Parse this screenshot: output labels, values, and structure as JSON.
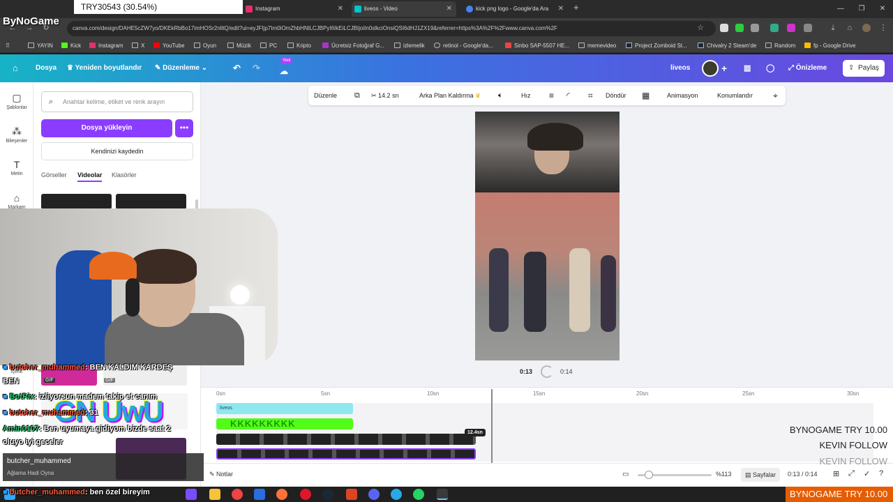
{
  "stream": {
    "brand": "ByNoGame",
    "currency_top": "TRY30543 (30.54%)",
    "ticker_right_1": "BYNOGAME  TRY 10.00",
    "ticker_right_2": "KEVIN  FOLLOW",
    "ticker_right_3": "KEVIN  FOLLOW",
    "ticker_bottom": "BYNOGAME  TRY 10.00",
    "chat": [
      {
        "user": "butcher_muhammed",
        "text": ": BEN KALDIM KARDEŞ"
      },
      {
        "user": "",
        "text": "BEN"
      },
      {
        "user": "BotRix",
        "text": ": izliyorsun madem takip et canım"
      },
      {
        "user": "butcher_muhammed",
        "text": ": 31"
      },
      {
        "user": "Amin0107",
        "text": ": Ben uyumaya gidiyom bizde saat 2"
      },
      {
        "user": "",
        "text": "oluyo iyi geceler"
      },
      {
        "user": "butcher_muhammed",
        "text": ": ben özel bireyim"
      }
    ],
    "alert": {
      "user": "butcher_muhammed",
      "text": "Ağlama Hadi Oyna"
    }
  },
  "browser": {
    "tabs": [
      {
        "label": "Instagram",
        "color": "#e1306c"
      },
      {
        "label": "liveos - Video",
        "color": "#00c4cc"
      },
      {
        "label": "kick png logo - Google'da Ara",
        "color": "#4285f4"
      }
    ],
    "new_tab": "+",
    "url": "canva.com/design/DAHE5cZW7yo/DKEkRbBo17imHOSr2nlltQ/edit?ui=eyJFIjp7Im0iOmZhbHNlLCJBPyI6IkEiLCJBIjoiIn0slkciOnsiQSI6dHJ1ZX19&referrer=https%3A%2F%2Fwww.canva.com%2F",
    "bookmarks": [
      "YAYIN",
      "Kick",
      "Instagram",
      "X",
      "YouTube",
      "Oyun",
      "Müzik",
      "PC",
      "Kripto",
      "Ücretsiz Fotoğraf G...",
      "izlemelik",
      "retinol - Google'da...",
      "Sinbo SAP-5507 HE...",
      "memevideo",
      "Project Zomboid St...",
      "Chivalry 2 Steam'de",
      "Random",
      "fp - Google Drive"
    ]
  },
  "canva": {
    "header": {
      "file": "Dosya",
      "resize": "Yeniden boyutlandır",
      "edit": "Düzenleme",
      "new_badge": "Yeni",
      "project": "liveos",
      "preview": "Önizleme",
      "share": "Paylaş"
    },
    "rail": [
      "Şablonlar",
      "Bileşenler",
      "Metin",
      "Markam",
      "İçerik"
    ],
    "panel": {
      "search_placeholder": "Anahtar kelime, etiket ve renk arayın",
      "upload": "Dosya yükleyin",
      "record": "Kendinizi kaydedin",
      "tabs": [
        "Görseller",
        "Videolar",
        "Klasörler"
      ],
      "gif": "GIF"
    },
    "toolbar": {
      "edit": "Düzenle",
      "duration": "14.2 sn",
      "bg_remove": "Arka Plan Kaldırma",
      "speed": "Hız",
      "rotate": "Döndür",
      "animation": "Animasyon",
      "position": "Konumlandır"
    },
    "player": {
      "current": "0:13",
      "total": "0:14"
    },
    "timeline": {
      "ticks": [
        "0sn",
        "5sn",
        "10sn",
        "15sn",
        "20sn",
        "25sn",
        "30sn"
      ],
      "track_label": "liveos",
      "clip_duration": "12.4sn"
    },
    "bottom": {
      "notes": "Notlar",
      "zoom": "%113",
      "pages": "Sayfalar",
      "time": "0:13 / 0:14"
    }
  }
}
